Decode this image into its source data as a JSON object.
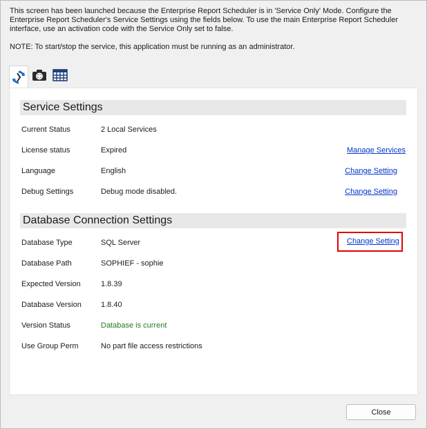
{
  "intro": {
    "message": "This screen has been launched because the Enterprise Report Scheduler is in 'Service Only' Mode. Configure the Enterprise Report Scheduler's Service Settings using the fields below. To use the main Enterprise Report Scheduler interface, use an activation code with the Service Only set to false.",
    "note": "NOTE: To start/stop the service, this application must be running as an administrator."
  },
  "tabs": [
    {
      "icon": "refresh-icon"
    },
    {
      "icon": "camera-icon"
    },
    {
      "icon": "grid-calendar-icon"
    }
  ],
  "service": {
    "title": "Service Settings",
    "rows": [
      {
        "label": "Current Status",
        "value": "2 Local Services",
        "link": ""
      },
      {
        "label": "License status",
        "value": "Expired",
        "link": "Manage Services"
      },
      {
        "label": "Language",
        "value": "English",
        "link": "Change Setting"
      },
      {
        "label": "Debug Settings",
        "value": "Debug mode disabled.",
        "link": "Change Setting"
      }
    ]
  },
  "database": {
    "title": "Database Connection Settings",
    "rows": [
      {
        "label": "Database Type",
        "value": "SQL Server",
        "link": "Change Setting"
      },
      {
        "label": "Database Path",
        "value": "SOPHIEF - sophie"
      },
      {
        "label": "Expected Version",
        "value": "1.8.39"
      },
      {
        "label": "Database Version",
        "value": "1.8.40"
      },
      {
        "label": "Version Status",
        "value": "Database is current",
        "value_color": "#1e7d1e"
      },
      {
        "label": "Use Group Perm",
        "value": "No part file access restrictions"
      }
    ]
  },
  "footer": {
    "close_label": "Close"
  },
  "colors": {
    "link": "#0033cc",
    "highlight": "#e00000",
    "status_ok": "#1e7d1e"
  }
}
